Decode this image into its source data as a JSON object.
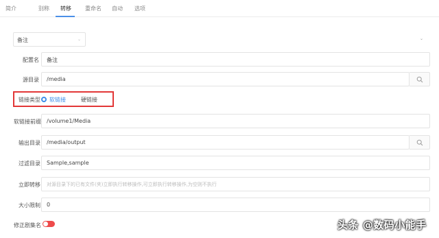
{
  "tabs": [
    {
      "label": "简介"
    },
    {
      "label": "别称"
    },
    {
      "label": "转移",
      "active": true
    },
    {
      "label": "重命名"
    },
    {
      "label": "自动"
    },
    {
      "label": "选项"
    }
  ],
  "profile_select": {
    "value": "备注"
  },
  "form": {
    "config_name": {
      "label": "配置名",
      "value": "备注"
    },
    "source_dir": {
      "label": "源目录",
      "value": "/media"
    },
    "link_type": {
      "label": "链接类型",
      "options": [
        "软链接",
        "硬链接"
      ],
      "selected": "软链接"
    },
    "softlink_prefix": {
      "label": "软链接前缀",
      "value": "/volume1/Media"
    },
    "output_dir": {
      "label": "输出目录",
      "value": "/media/output"
    },
    "filter_dir": {
      "label": "过滤目录",
      "value": "Sample,sample"
    },
    "immediate_transfer": {
      "label": "立即转移",
      "placeholder": "对源目录下的已有文件(夹)立即执行转移操作,可立即执行转移操作,为空则不执行"
    },
    "size_limit": {
      "label": "大小限制",
      "value": "0"
    },
    "fix_season": {
      "label": "修正剧集名",
      "enabled": true
    }
  },
  "watermark": "头条 @数码小能手",
  "accent_color": "#3d8eea",
  "highlight_color": "#e23636",
  "toggle_color": "#ee4b4b"
}
